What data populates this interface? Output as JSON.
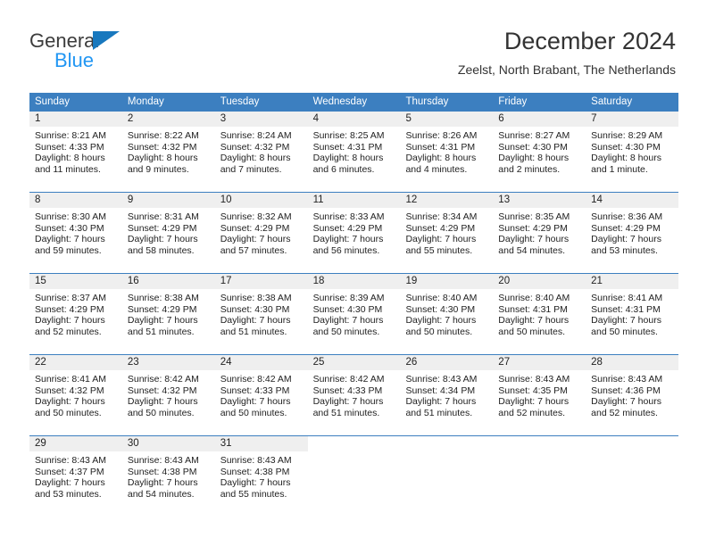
{
  "brand": {
    "name_part1": "General",
    "name_part2": "Blue",
    "logo_icon": "triangle-logo-icon",
    "color_primary": "#1878be",
    "color_secondary": "#2196f3"
  },
  "header": {
    "title": "December 2024",
    "subtitle": "Zeelst, North Brabant, The Netherlands"
  },
  "theme": {
    "header_blue": "#3c7fc0",
    "day_band_gray": "#efefef",
    "text": "#222222"
  },
  "weekdays": [
    "Sunday",
    "Monday",
    "Tuesday",
    "Wednesday",
    "Thursday",
    "Friday",
    "Saturday"
  ],
  "weeks": [
    [
      {
        "day": "1",
        "sunrise": "Sunrise: 8:21 AM",
        "sunset": "Sunset: 4:33 PM",
        "daylight": "Daylight: 8 hours and 11 minutes."
      },
      {
        "day": "2",
        "sunrise": "Sunrise: 8:22 AM",
        "sunset": "Sunset: 4:32 PM",
        "daylight": "Daylight: 8 hours and 9 minutes."
      },
      {
        "day": "3",
        "sunrise": "Sunrise: 8:24 AM",
        "sunset": "Sunset: 4:32 PM",
        "daylight": "Daylight: 8 hours and 7 minutes."
      },
      {
        "day": "4",
        "sunrise": "Sunrise: 8:25 AM",
        "sunset": "Sunset: 4:31 PM",
        "daylight": "Daylight: 8 hours and 6 minutes."
      },
      {
        "day": "5",
        "sunrise": "Sunrise: 8:26 AM",
        "sunset": "Sunset: 4:31 PM",
        "daylight": "Daylight: 8 hours and 4 minutes."
      },
      {
        "day": "6",
        "sunrise": "Sunrise: 8:27 AM",
        "sunset": "Sunset: 4:30 PM",
        "daylight": "Daylight: 8 hours and 2 minutes."
      },
      {
        "day": "7",
        "sunrise": "Sunrise: 8:29 AM",
        "sunset": "Sunset: 4:30 PM",
        "daylight": "Daylight: 8 hours and 1 minute."
      }
    ],
    [
      {
        "day": "8",
        "sunrise": "Sunrise: 8:30 AM",
        "sunset": "Sunset: 4:30 PM",
        "daylight": "Daylight: 7 hours and 59 minutes."
      },
      {
        "day": "9",
        "sunrise": "Sunrise: 8:31 AM",
        "sunset": "Sunset: 4:29 PM",
        "daylight": "Daylight: 7 hours and 58 minutes."
      },
      {
        "day": "10",
        "sunrise": "Sunrise: 8:32 AM",
        "sunset": "Sunset: 4:29 PM",
        "daylight": "Daylight: 7 hours and 57 minutes."
      },
      {
        "day": "11",
        "sunrise": "Sunrise: 8:33 AM",
        "sunset": "Sunset: 4:29 PM",
        "daylight": "Daylight: 7 hours and 56 minutes."
      },
      {
        "day": "12",
        "sunrise": "Sunrise: 8:34 AM",
        "sunset": "Sunset: 4:29 PM",
        "daylight": "Daylight: 7 hours and 55 minutes."
      },
      {
        "day": "13",
        "sunrise": "Sunrise: 8:35 AM",
        "sunset": "Sunset: 4:29 PM",
        "daylight": "Daylight: 7 hours and 54 minutes."
      },
      {
        "day": "14",
        "sunrise": "Sunrise: 8:36 AM",
        "sunset": "Sunset: 4:29 PM",
        "daylight": "Daylight: 7 hours and 53 minutes."
      }
    ],
    [
      {
        "day": "15",
        "sunrise": "Sunrise: 8:37 AM",
        "sunset": "Sunset: 4:29 PM",
        "daylight": "Daylight: 7 hours and 52 minutes."
      },
      {
        "day": "16",
        "sunrise": "Sunrise: 8:38 AM",
        "sunset": "Sunset: 4:29 PM",
        "daylight": "Daylight: 7 hours and 51 minutes."
      },
      {
        "day": "17",
        "sunrise": "Sunrise: 8:38 AM",
        "sunset": "Sunset: 4:30 PM",
        "daylight": "Daylight: 7 hours and 51 minutes."
      },
      {
        "day": "18",
        "sunrise": "Sunrise: 8:39 AM",
        "sunset": "Sunset: 4:30 PM",
        "daylight": "Daylight: 7 hours and 50 minutes."
      },
      {
        "day": "19",
        "sunrise": "Sunrise: 8:40 AM",
        "sunset": "Sunset: 4:30 PM",
        "daylight": "Daylight: 7 hours and 50 minutes."
      },
      {
        "day": "20",
        "sunrise": "Sunrise: 8:40 AM",
        "sunset": "Sunset: 4:31 PM",
        "daylight": "Daylight: 7 hours and 50 minutes."
      },
      {
        "day": "21",
        "sunrise": "Sunrise: 8:41 AM",
        "sunset": "Sunset: 4:31 PM",
        "daylight": "Daylight: 7 hours and 50 minutes."
      }
    ],
    [
      {
        "day": "22",
        "sunrise": "Sunrise: 8:41 AM",
        "sunset": "Sunset: 4:32 PM",
        "daylight": "Daylight: 7 hours and 50 minutes."
      },
      {
        "day": "23",
        "sunrise": "Sunrise: 8:42 AM",
        "sunset": "Sunset: 4:32 PM",
        "daylight": "Daylight: 7 hours and 50 minutes."
      },
      {
        "day": "24",
        "sunrise": "Sunrise: 8:42 AM",
        "sunset": "Sunset: 4:33 PM",
        "daylight": "Daylight: 7 hours and 50 minutes."
      },
      {
        "day": "25",
        "sunrise": "Sunrise: 8:42 AM",
        "sunset": "Sunset: 4:33 PM",
        "daylight": "Daylight: 7 hours and 51 minutes."
      },
      {
        "day": "26",
        "sunrise": "Sunrise: 8:43 AM",
        "sunset": "Sunset: 4:34 PM",
        "daylight": "Daylight: 7 hours and 51 minutes."
      },
      {
        "day": "27",
        "sunrise": "Sunrise: 8:43 AM",
        "sunset": "Sunset: 4:35 PM",
        "daylight": "Daylight: 7 hours and 52 minutes."
      },
      {
        "day": "28",
        "sunrise": "Sunrise: 8:43 AM",
        "sunset": "Sunset: 4:36 PM",
        "daylight": "Daylight: 7 hours and 52 minutes."
      }
    ],
    [
      {
        "day": "29",
        "sunrise": "Sunrise: 8:43 AM",
        "sunset": "Sunset: 4:37 PM",
        "daylight": "Daylight: 7 hours and 53 minutes."
      },
      {
        "day": "30",
        "sunrise": "Sunrise: 8:43 AM",
        "sunset": "Sunset: 4:38 PM",
        "daylight": "Daylight: 7 hours and 54 minutes."
      },
      {
        "day": "31",
        "sunrise": "Sunrise: 8:43 AM",
        "sunset": "Sunset: 4:38 PM",
        "daylight": "Daylight: 7 hours and 55 minutes."
      },
      {
        "day": "",
        "sunrise": "",
        "sunset": "",
        "daylight": ""
      },
      {
        "day": "",
        "sunrise": "",
        "sunset": "",
        "daylight": ""
      },
      {
        "day": "",
        "sunrise": "",
        "sunset": "",
        "daylight": ""
      },
      {
        "day": "",
        "sunrise": "",
        "sunset": "",
        "daylight": ""
      }
    ]
  ]
}
